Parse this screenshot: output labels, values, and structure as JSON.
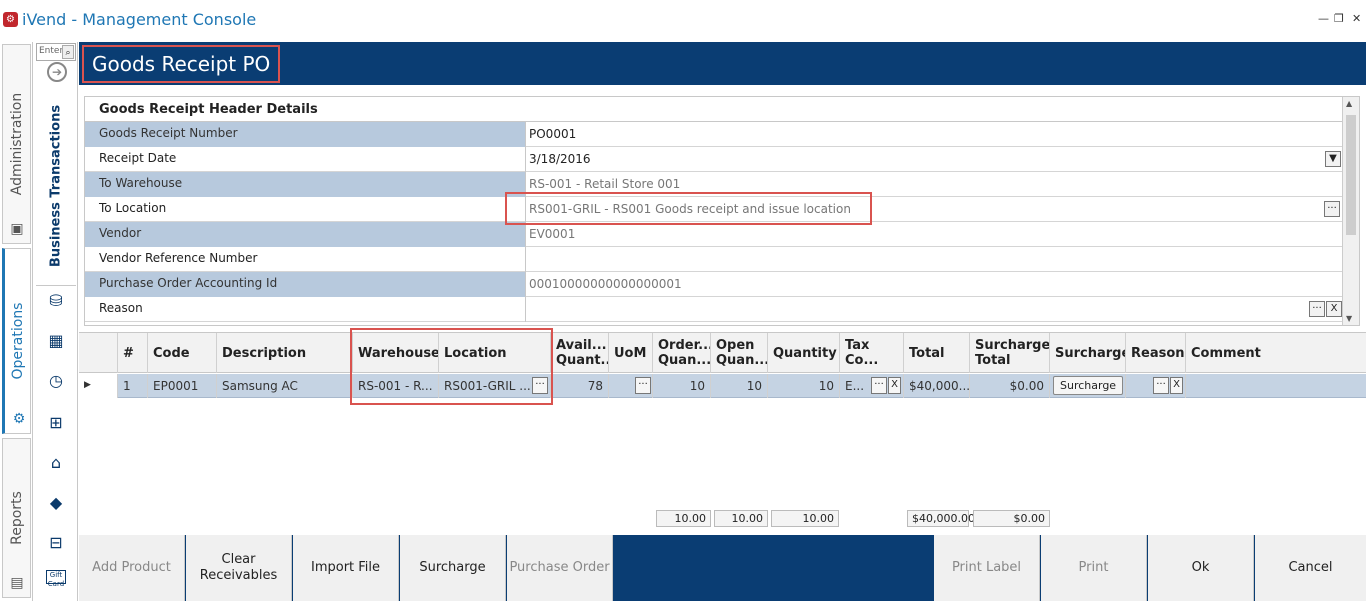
{
  "app": {
    "title": "iVend - Management Console",
    "logo": "ivend-logo-icon"
  },
  "window_controls": [
    "minimize-icon",
    "restore-icon",
    "close-icon"
  ],
  "vertical_tabs": {
    "administration": "Administration",
    "operations": "Operations",
    "reports": "Reports"
  },
  "nav": {
    "search_placeholder": "Enter",
    "section": "Business Transactions",
    "icons": [
      "customer-payment-icon",
      "register-icon",
      "clock-icon",
      "gift-icon",
      "warehouse-icon",
      "tag-icon",
      "store-cash-icon",
      "gift-card-icon"
    ],
    "gift_card_text": "Gift Card"
  },
  "page": {
    "title": "Goods Receipt PO"
  },
  "header": {
    "caption": "Goods Receipt Header Details",
    "rows": [
      {
        "label": "Goods Receipt Number",
        "value": "PO0001"
      },
      {
        "label": "Receipt Date",
        "value": "3/18/2016"
      },
      {
        "label": "To Warehouse",
        "value": "RS-001 - Retail Store 001"
      },
      {
        "label": "To Location",
        "value": "RS001-GRIL - RS001 Goods receipt and issue location"
      },
      {
        "label": "Vendor",
        "value": "EV0001"
      },
      {
        "label": "Vendor Reference Number",
        "value": ""
      },
      {
        "label": "Purchase Order Accounting Id",
        "value": "00010000000000000001"
      },
      {
        "label": "Reason",
        "value": ""
      }
    ],
    "ellipsis": "···",
    "clear": "X",
    "dropdown": "▼"
  },
  "grid": {
    "columns": {
      "num": "#",
      "code": "Code",
      "description": "Description",
      "warehouse": "Warehouse",
      "location": "Location",
      "available": "Avail... Quant...",
      "uom": "UoM",
      "ordered": "Order... Quan...",
      "open": "Open Quan...",
      "quantity": "Quantity",
      "tax": "Tax Co...",
      "total": "Total",
      "surcharge_total": "Surcharge Total",
      "surcharge": "Surcharge",
      "reason": "Reason",
      "comment": "Comment"
    },
    "rows": [
      {
        "num": "1",
        "code": "EP0001",
        "description": "Samsung AC",
        "warehouse": "RS-001 - R...",
        "location": "RS001-GRIL ...",
        "available": "78",
        "ordered": "10",
        "open": "10",
        "quantity": "10",
        "tax": "E...",
        "total": "$40,000...",
        "surcharge_total": "$0.00",
        "surcharge_button": "Surcharge"
      }
    ],
    "totals": {
      "ordered": "10.00",
      "open": "10.00",
      "quantity": "10.00",
      "total": "$40,000.00",
      "surcharge_total": "$0.00"
    }
  },
  "toolbar": {
    "add_product": "Add Product",
    "clear_receivables": "Clear Receivables",
    "import_file": "Import File",
    "surcharge": "Surcharge",
    "purchase_order": "Purchase Order",
    "print_label": "Print Label",
    "print": "Print",
    "ok": "Ok",
    "cancel": "Cancel"
  },
  "colors": {
    "header_blue": "#0a3d73",
    "label_shade": "#b7c9dd",
    "row_selected": "#c5d3e3",
    "highlight_red": "#d9534f",
    "title_blue": "#1f77b4"
  }
}
